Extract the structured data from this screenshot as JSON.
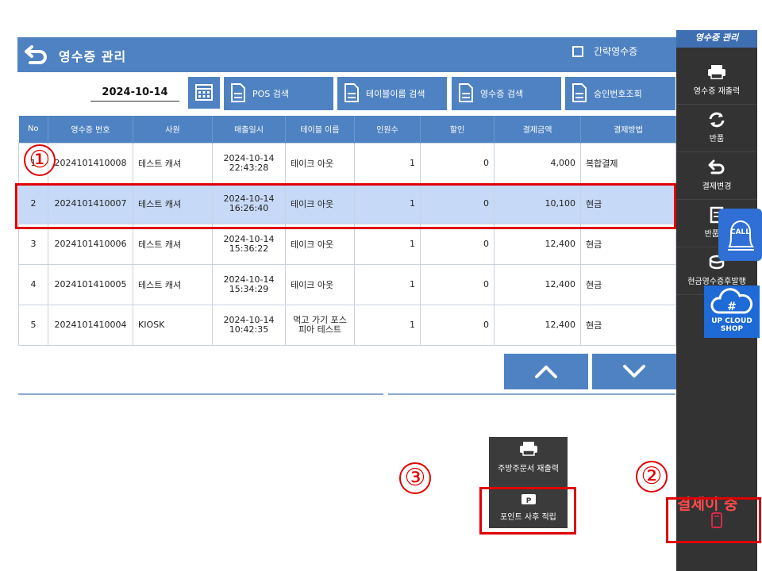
{
  "header": {
    "title": "영수증 관리",
    "simple_receipt_label": "간략영수증"
  },
  "search": {
    "date": "2024-10-14",
    "buttons": [
      "POS 검색",
      "테이블이름 검색",
      "영수증 검색",
      "승인번호조회"
    ]
  },
  "table": {
    "columns": [
      "No",
      "영수증 번호",
      "사원",
      "매출일시",
      "테이블 이름",
      "인원수",
      "할인",
      "결제금액",
      "결제방법"
    ],
    "rows": [
      {
        "no": "1",
        "receipt": "2024101410008",
        "staff": "테스트 캐셔",
        "date": "2024-10-14",
        "time": "22:43:28",
        "table": "테이크 아웃",
        "people": "1",
        "discount": "0",
        "amount": "4,000",
        "method": "복합결제"
      },
      {
        "no": "2",
        "receipt": "2024101410007",
        "staff": "테스트 캐셔",
        "date": "2024-10-14",
        "time": "16:26:40",
        "table": "테이크 아웃",
        "people": "1",
        "discount": "0",
        "amount": "10,100",
        "method": "현금"
      },
      {
        "no": "3",
        "receipt": "2024101410006",
        "staff": "테스트 캐셔",
        "date": "2024-10-14",
        "time": "15:36:22",
        "table": "테이크 아웃",
        "people": "1",
        "discount": "0",
        "amount": "12,400",
        "method": "현금"
      },
      {
        "no": "4",
        "receipt": "2024101410005",
        "staff": "테스트 캐셔",
        "date": "2024-10-14",
        "time": "15:34:29",
        "table": "테이크 아웃",
        "people": "1",
        "discount": "0",
        "amount": "12,400",
        "method": "현금"
      },
      {
        "no": "5",
        "receipt": "2024101410004",
        "staff": "KIOSK",
        "date": "2024-10-14",
        "time": "10:42:35",
        "table": "먹고 가기 포스피아 테스트",
        "people": "1",
        "discount": "0",
        "amount": "12,400",
        "method": "현금"
      }
    ],
    "selected_index": 1
  },
  "sidebar": {
    "title": "영수증 관리",
    "items": [
      {
        "label": "영수증 재출력",
        "icon": "printer-icon"
      },
      {
        "label": "반품",
        "icon": "refresh-icon"
      },
      {
        "label": "결제변경",
        "icon": "undo-icon"
      },
      {
        "label": "반품 후",
        "icon": "receipt-icon"
      },
      {
        "label": "현금영수증후발행",
        "icon": "coins-icon"
      }
    ],
    "pay_status": "결제이 중"
  },
  "call_badge": "CALL",
  "cloud_badge": {
    "line1": "UP CLOUD",
    "line2": "SHOP"
  },
  "popup": {
    "kitchen_reprint": "주방주문서 재출력",
    "point_later": "포인트 사후 적립"
  },
  "annotations": [
    "①",
    "②",
    "③"
  ],
  "colors": {
    "primary": "#4f82c2",
    "selected_row": "#c6d9f6",
    "sidebar": "#333333",
    "highlight": "#e00000"
  }
}
